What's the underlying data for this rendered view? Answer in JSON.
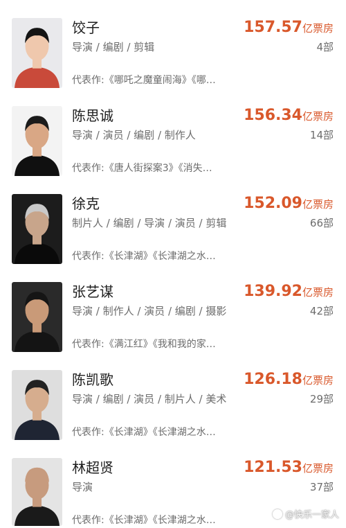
{
  "directors": [
    {
      "name": "饺子",
      "roles": "导演 / 编剧 / 剪辑",
      "works": "代表作:《哪吒之魔童闹海》《哪…",
      "box_office": "157.57",
      "unit": "亿票房",
      "film_count": "4部",
      "photo": {
        "bg": "#e9e9ec",
        "hair": "#141414",
        "skin": "#efc8ad",
        "shirt": "#c94a3a"
      }
    },
    {
      "name": "陈思诚",
      "roles": "导演 / 演员 / 编剧 / 制作人",
      "works": "代表作:《唐人街探案3》《消失…",
      "box_office": "156.34",
      "unit": "亿票房",
      "film_count": "14部",
      "photo": {
        "bg": "#f3f3f3",
        "hair": "#1b1b1b",
        "skin": "#d9a785",
        "shirt": "#101010"
      }
    },
    {
      "name": "徐克",
      "roles": "制片人 / 编剧 / 导演 / 演员 / 剪辑",
      "works": "代表作:《长津湖》《长津湖之水…",
      "box_office": "152.09",
      "unit": "亿票房",
      "film_count": "66部",
      "photo": {
        "bg": "#1c1c1c",
        "hair": "#c9c9c9",
        "skin": "#c8a58b",
        "shirt": "#0a0a0a"
      }
    },
    {
      "name": "张艺谋",
      "roles": "导演 / 制作人 / 演员 / 编剧 / 摄影",
      "works": "代表作:《满江红》《我和我的家…",
      "box_office": "139.92",
      "unit": "亿票房",
      "film_count": "42部",
      "photo": {
        "bg": "#2a2a2a",
        "hair": "#151515",
        "skin": "#c99a78",
        "shirt": "#141414"
      }
    },
    {
      "name": "陈凯歌",
      "roles": "导演 / 编剧 / 演员 / 制片人 / 美术",
      "works": "代表作:《长津湖》《长津湖之水…",
      "box_office": "126.18",
      "unit": "亿票房",
      "film_count": "29部",
      "photo": {
        "bg": "#dedede",
        "hair": "#222222",
        "skin": "#d6ad8e",
        "shirt": "#1f2533"
      }
    },
    {
      "name": "林超贤",
      "roles": "导演",
      "works": "代表作:《长津湖》《长津湖之水…",
      "box_office": "121.53",
      "unit": "亿票房",
      "film_count": "37部",
      "photo": {
        "bg": "#e4e4e4",
        "hair": "#c79b7e",
        "skin": "#c79b7e",
        "shirt": "#1a1a1a"
      }
    }
  ],
  "watermark": {
    "text": "@快乐一家人",
    "icon": "toutiao-logo-icon"
  },
  "accent_color": "#d9582b"
}
